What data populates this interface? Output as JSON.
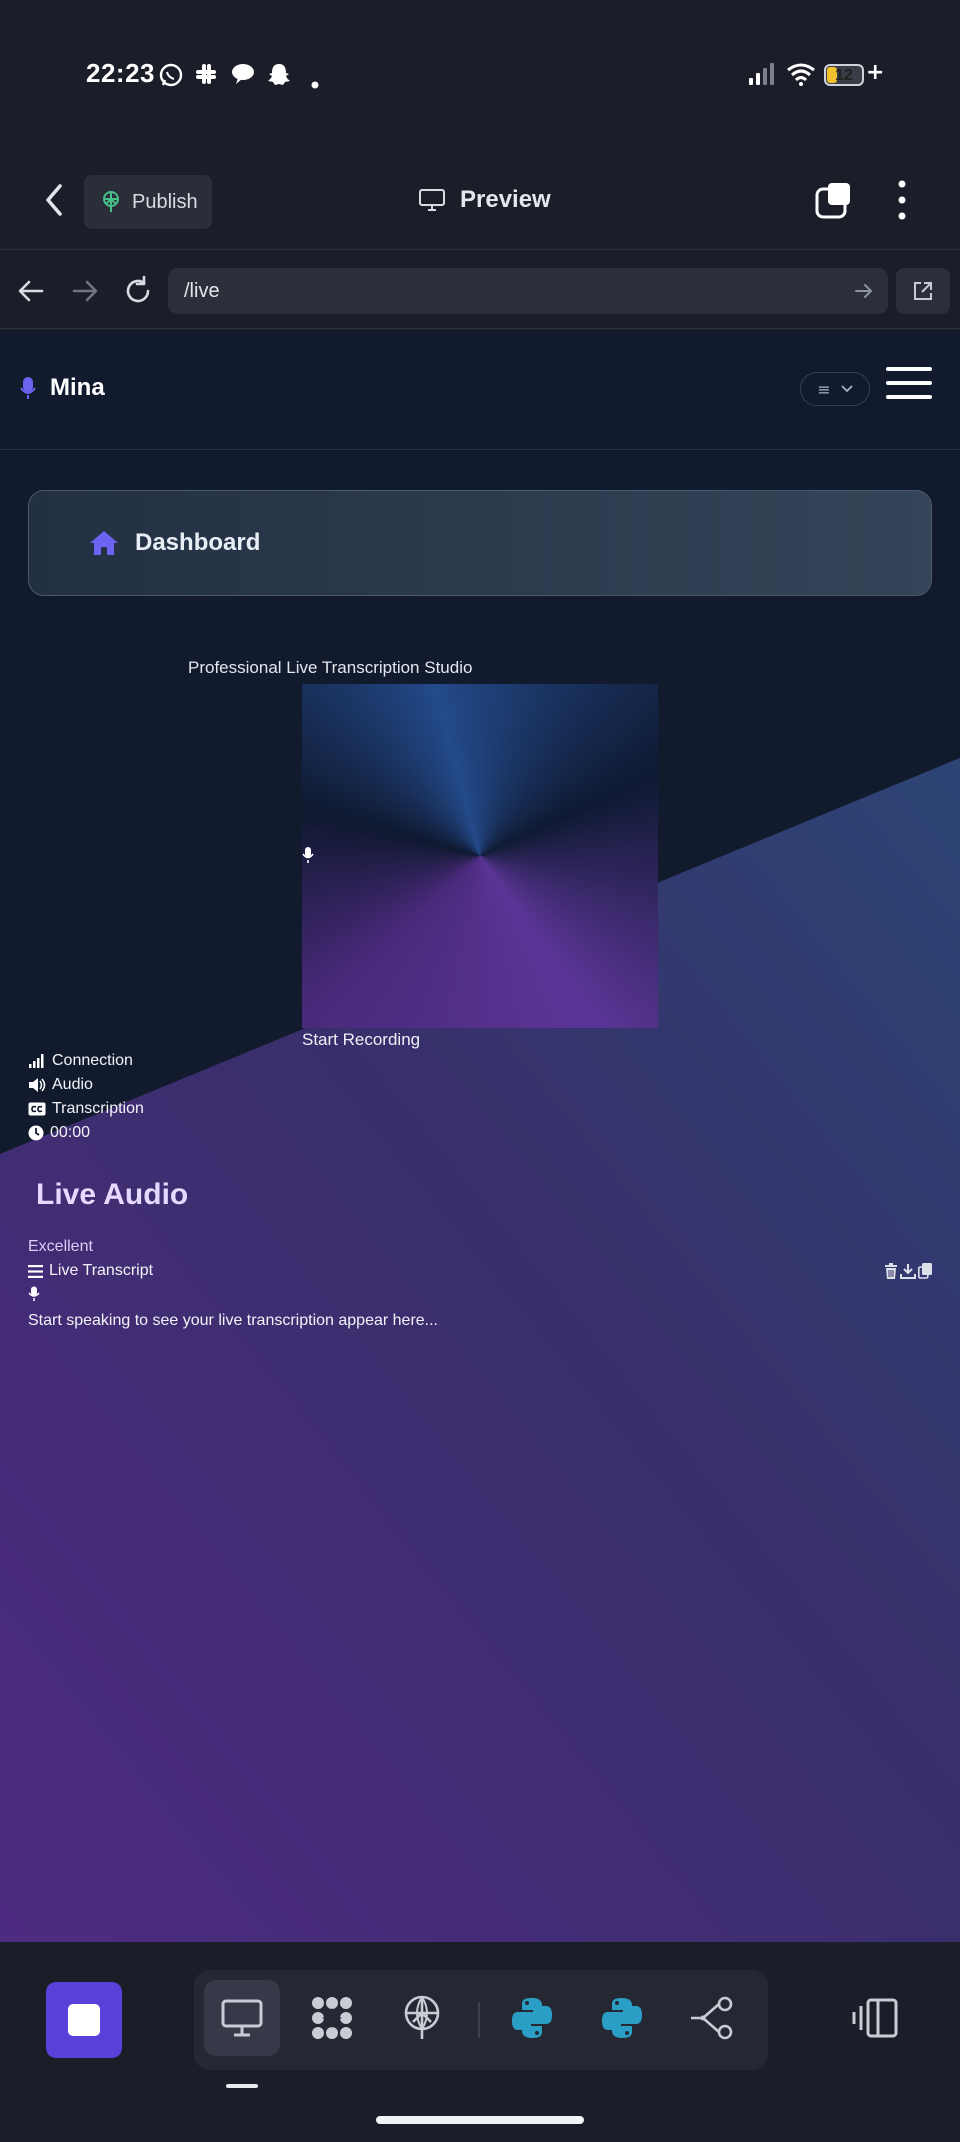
{
  "status_bar": {
    "time": "22:23",
    "battery": "12",
    "battery_level": 0.12,
    "icons": [
      "whatsapp-icon",
      "slack-icon",
      "chat-bubble-icon",
      "snapchat-icon",
      "dot-icon",
      "signal-icon",
      "wifi-icon",
      "battery-icon",
      "charging-icon"
    ]
  },
  "app_bar": {
    "publish_label": "Publish",
    "preview_label": "Preview"
  },
  "browser": {
    "url": "/live"
  },
  "site": {
    "brand": "Mina",
    "menu_glyph": "≡",
    "dashboard_label": "Dashboard",
    "studio_title": "Professional Live Transcription Studio",
    "record_label": "Start Recording",
    "stats": {
      "connection": "Connection",
      "audio": "Audio",
      "transcription": "Transcription",
      "timer": "00:00"
    },
    "live_audio_title": "Live Audio",
    "quality": "Excellent",
    "transcript_title": "Live Transcript",
    "transcript_placeholder": "Start speaking to see your live transcription appear here..."
  },
  "colors": {
    "accent": "#5a3fd9",
    "dashboard_icon": "#6c63f0",
    "publish_icon": "#48c08a",
    "python_icon": "#2a9ec5"
  }
}
